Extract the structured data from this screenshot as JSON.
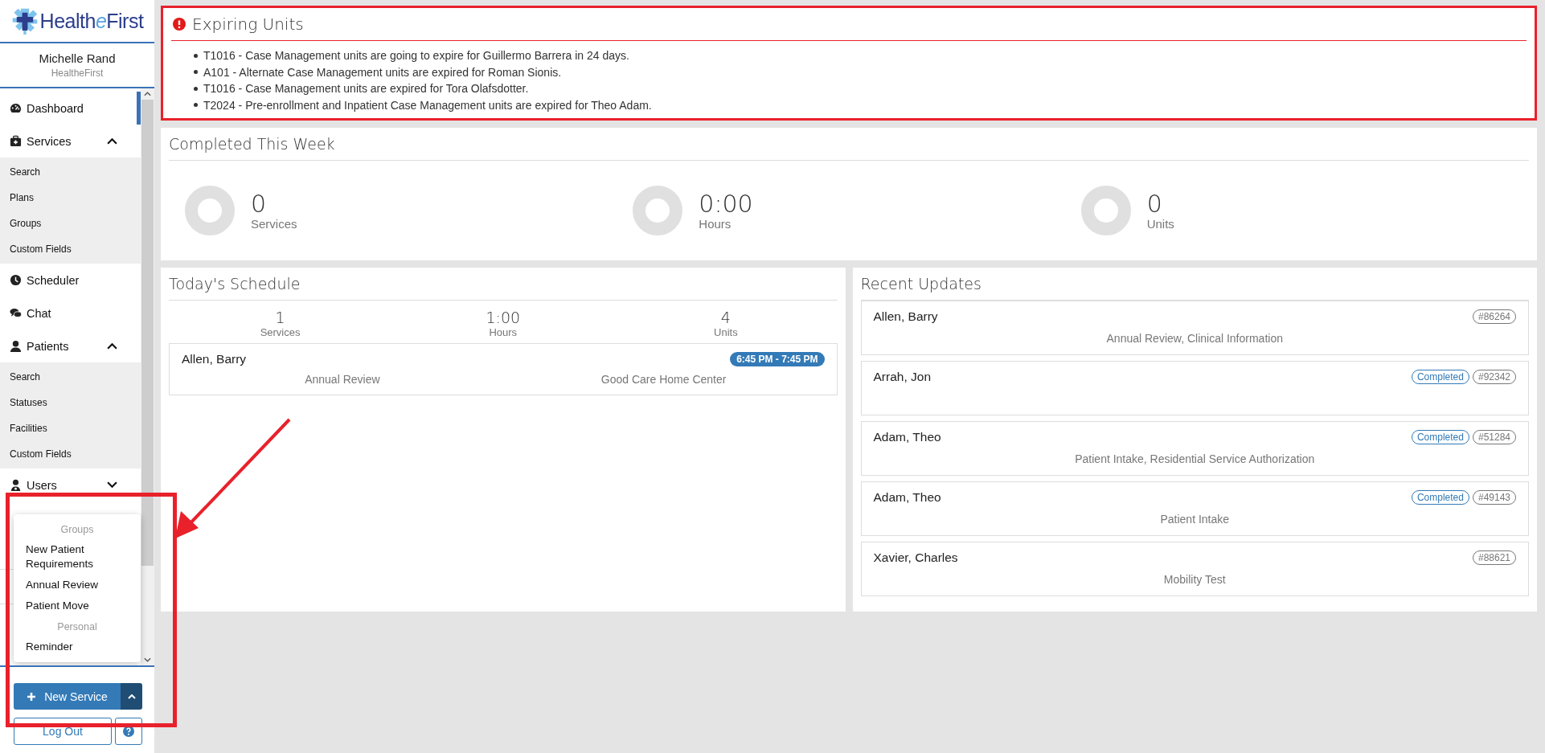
{
  "logo": {
    "start": "Health",
    "mark": "e",
    "end": "First"
  },
  "user": {
    "name": "Michelle Rand",
    "organization": "HealtheFirst"
  },
  "nav": [
    {
      "label": "Dashboard",
      "kind": "link",
      "selected": true
    },
    {
      "label": "Services",
      "kind": "group",
      "expanded": true,
      "selected": false,
      "children": [
        {
          "label": "Search"
        },
        {
          "label": "Plans"
        },
        {
          "label": "Groups"
        },
        {
          "label": "Custom Fields"
        }
      ]
    },
    {
      "label": "Scheduler",
      "kind": "link",
      "selected": false
    },
    {
      "label": "Chat",
      "kind": "link",
      "selected": false
    },
    {
      "label": "Patients",
      "kind": "group",
      "expanded": true,
      "selected": false,
      "children": [
        {
          "label": "Search"
        },
        {
          "label": "Statuses"
        },
        {
          "label": "Facilities"
        },
        {
          "label": "Custom Fields"
        }
      ]
    },
    {
      "label": "Users",
      "kind": "group",
      "expanded": false,
      "selected": false
    }
  ],
  "new_service_menu": {
    "open": true,
    "sections": [
      {
        "heading": "Groups",
        "items": [
          "New Patient Requirements",
          "Annual Review",
          "Patient Move"
        ]
      },
      {
        "heading": "Personal",
        "items": [
          "Reminder"
        ]
      }
    ]
  },
  "new_service_button": "New Service",
  "logout_button": "Log Out",
  "expiring_units": {
    "title": "Expiring Units",
    "items": [
      "T1016 - Case Management units are going to expire for Guillermo Barrera in 24 days.",
      "A101 - Alternate Case Management units are expired for Roman Sionis.",
      "T1016 - Case Management units are expired for Tora Olafsdotter.",
      "T2024 - Pre-enrollment and Inpatient Case Management units are expired for Theo Adam."
    ]
  },
  "completed_this_week": {
    "title": "Completed This Week",
    "stats": [
      {
        "value": "0",
        "label": "Services"
      },
      {
        "value": "0:00",
        "label": "Hours"
      },
      {
        "value": "0",
        "label": "Units"
      }
    ]
  },
  "todays_schedule": {
    "title": "Today's Schedule",
    "stats": [
      {
        "value": "1",
        "label": "Services"
      },
      {
        "value": "1:00",
        "label": "Hours"
      },
      {
        "value": "4",
        "label": "Units"
      }
    ],
    "appointments": [
      {
        "patient": "Allen, Barry",
        "time": "6:45 PM - 7:45 PM",
        "service": "Annual Review",
        "facility": "Good Care Home Center"
      }
    ]
  },
  "recent_updates": {
    "title": "Recent Updates",
    "items": [
      {
        "patient": "Allen, Barry",
        "number": "#86264",
        "services": "Annual Review, Clinical Information"
      },
      {
        "patient": "Arrah, Jon",
        "status": "Completed",
        "number": "#92342"
      },
      {
        "patient": "Adam, Theo",
        "status": "Completed",
        "number": "#51284",
        "services": "Patient Intake, Residential Service Authorization"
      },
      {
        "patient": "Adam, Theo",
        "status": "Completed",
        "number": "#49143",
        "services": "Patient Intake"
      },
      {
        "patient": "Xavier, Charles",
        "number": "#88621",
        "services": "Mobility Test"
      }
    ]
  }
}
